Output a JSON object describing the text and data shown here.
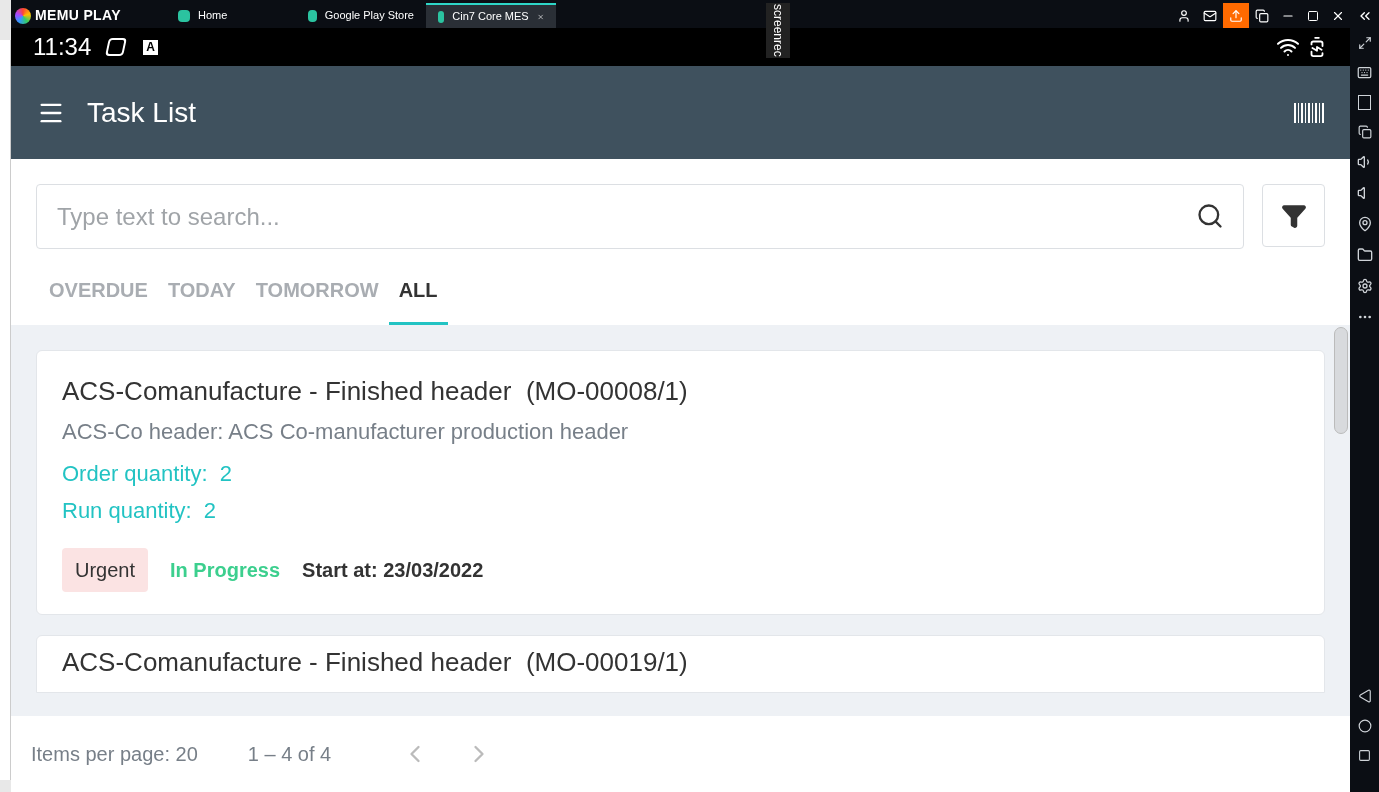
{
  "emulator": {
    "brand": "MEMU PLAY",
    "tabs": [
      {
        "label": "Home",
        "selected": false,
        "closable": false
      },
      {
        "label": "Google Play Store",
        "selected": false,
        "closable": false
      },
      {
        "label": "Cin7 Core MES",
        "selected": true,
        "closable": true
      }
    ],
    "recording_label": "screenrec"
  },
  "status_bar": {
    "time": "11:34",
    "badge": "A"
  },
  "app_bar": {
    "title": "Task List"
  },
  "search": {
    "placeholder": "Type text to search..."
  },
  "filter_tabs": [
    {
      "label": "OVERDUE",
      "selected": false
    },
    {
      "label": "TODAY",
      "selected": false
    },
    {
      "label": "TOMORROW",
      "selected": false
    },
    {
      "label": "ALL",
      "selected": true
    }
  ],
  "tasks": [
    {
      "title": "ACS-Comanufacture - Finished header  (MO-00008/1)",
      "subtitle": "ACS-Co header: ACS Co-manufacturer production header",
      "order_quantity": "Order quantity:  2",
      "run_quantity": "Run quantity:  2",
      "priority": "Urgent",
      "status": "In Progress",
      "start": "Start at: 23/03/2022"
    },
    {
      "title": "ACS-Comanufacture - Finished header  (MO-00019/1)"
    }
  ],
  "pagination": {
    "items_per_page": "Items per page: 20",
    "range": "1 – 4 of 4"
  }
}
